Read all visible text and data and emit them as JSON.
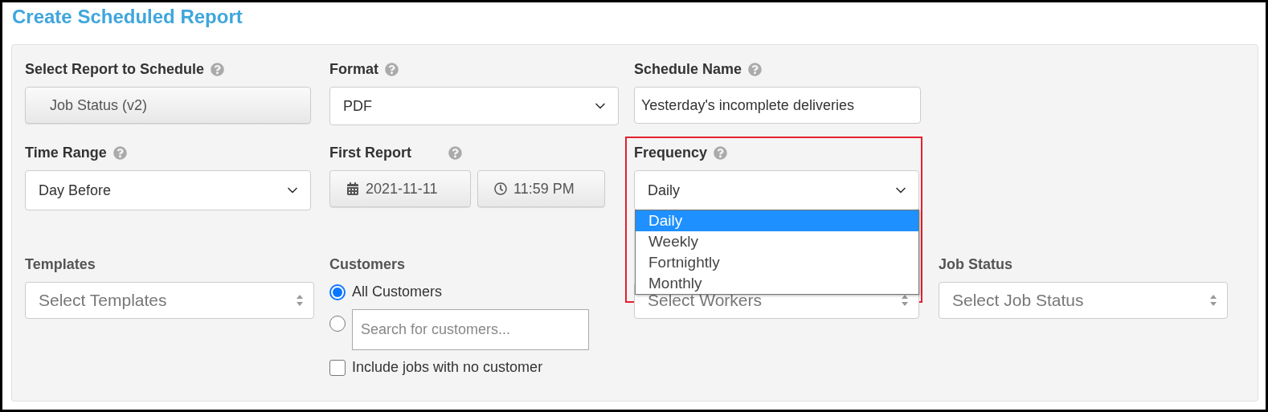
{
  "title": "Create Scheduled Report",
  "rows": [
    [
      {
        "kind": "button",
        "label": "Select Report to Schedule",
        "help": true,
        "value": "Job Status (v2)"
      },
      {
        "kind": "select",
        "label": "Format",
        "help": true,
        "value": "PDF"
      },
      {
        "kind": "text",
        "label": "Schedule Name",
        "help": true,
        "value": "Yesterday's incomplete deliveries"
      }
    ],
    [
      {
        "kind": "select",
        "label": "Time Range",
        "help": true,
        "value": "Day Before"
      },
      {
        "kind": "datetime",
        "label": "First Report",
        "help": true,
        "date": "2021-11-11",
        "time": "11:59 PM"
      },
      {
        "kind": "dropdown",
        "label": "Frequency",
        "help": true,
        "value": "Daily",
        "highlighted": true,
        "options": [
          {
            "label": "Daily",
            "selected": true
          },
          {
            "label": "Weekly",
            "selected": false
          },
          {
            "label": "Fortnightly",
            "selected": false
          },
          {
            "label": "Monthly",
            "selected": false
          }
        ]
      }
    ],
    [
      {
        "kind": "multiselect",
        "label": "Templates",
        "placeholder": "Select Templates"
      },
      {
        "kind": "customers",
        "label": "Customers",
        "options": [
          {
            "kind": "radio",
            "label": "All Customers",
            "selected": true
          },
          {
            "kind": "search",
            "placeholder": "Search for customers...",
            "selected": false
          }
        ],
        "include_none": {
          "label": "Include jobs with no customer",
          "checked": false
        }
      },
      {
        "kind": "multiselect",
        "placeholder": "Select Workers"
      },
      {
        "kind": "multiselect",
        "label": "Job Status",
        "placeholder": "Select Job Status"
      }
    ]
  ]
}
